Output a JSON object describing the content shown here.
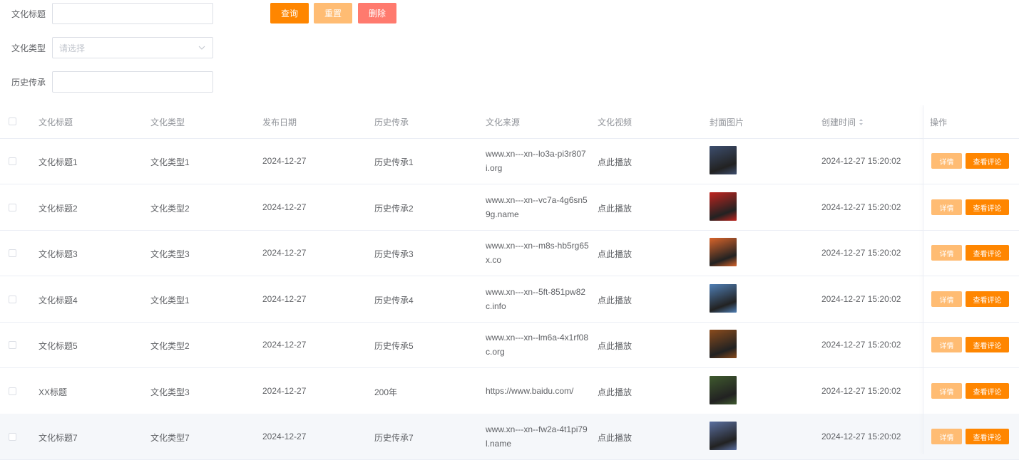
{
  "filters": {
    "title_label": "文化标题",
    "type_label": "文化类型",
    "type_placeholder": "请选择",
    "history_label": "历史传承"
  },
  "buttons": {
    "query": "查询",
    "reset": "重置",
    "delete": "删除"
  },
  "table": {
    "headers": [
      "文化标题",
      "文化类型",
      "发布日期",
      "历史传承",
      "文化来源",
      "文化视频",
      "封面图片",
      "创建时间",
      "操作"
    ],
    "rows": [
      {
        "title": "文化标题1",
        "type": "文化类型1",
        "date": "2024-12-27",
        "history": "历史传承1",
        "source": "www.xn---xn--lo3a-pi3r807i.org",
        "video": "点此播放",
        "created": "2024-12-27 15:20:02",
        "detail": "详情",
        "comment": "查看评论",
        "thumb_color": "#3d4e6e"
      },
      {
        "title": "文化标题2",
        "type": "文化类型2",
        "date": "2024-12-27",
        "history": "历史传承2",
        "source": "www.xn---xn--vc7a-4g6sn59g.name",
        "video": "点此播放",
        "created": "2024-12-27 15:20:02",
        "detail": "详情",
        "comment": "查看评论",
        "thumb_color": "#c0241f"
      },
      {
        "title": "文化标题3",
        "type": "文化类型3",
        "date": "2024-12-27",
        "history": "历史传承3",
        "source": "www.xn---xn--m8s-hb5rg65x.co",
        "video": "点此播放",
        "created": "2024-12-27 15:20:02",
        "detail": "详情",
        "comment": "查看评论",
        "thumb_color": "#d8642a"
      },
      {
        "title": "文化标题4",
        "type": "文化类型1",
        "date": "2024-12-27",
        "history": "历史传承4",
        "source": "www.xn---xn--5ft-851pw82c.info",
        "video": "点此播放",
        "created": "2024-12-27 15:20:02",
        "detail": "详情",
        "comment": "查看评论",
        "thumb_color": "#4f7fb5"
      },
      {
        "title": "文化标题5",
        "type": "文化类型2",
        "date": "2024-12-27",
        "history": "历史传承5",
        "source": "www.xn---xn--lm6a-4x1rf08c.org",
        "video": "点此播放",
        "created": "2024-12-27 15:20:02",
        "detail": "详情",
        "comment": "查看评论",
        "thumb_color": "#8a4b1c"
      },
      {
        "title": "XX标题",
        "type": "文化类型3",
        "date": "2024-12-27",
        "history": "200年",
        "source": "https://www.baidu.com/",
        "video": "点此播放",
        "created": "2024-12-27 15:20:02",
        "detail": "详情",
        "comment": "查看评论",
        "thumb_color": "#3f5a2e"
      },
      {
        "title": "文化标题7",
        "type": "文化类型7",
        "date": "2024-12-27",
        "history": "历史传承7",
        "source": "www.xn---xn--fw2a-4t1pi79l.name",
        "video": "点此播放",
        "created": "2024-12-27 15:20:02",
        "detail": "详情",
        "comment": "查看评论",
        "thumb_color": "#5a6fa0"
      }
    ]
  },
  "colors": {
    "primary": "#ff8600",
    "reset": "#ffbc73",
    "danger": "#ff7a6e"
  }
}
